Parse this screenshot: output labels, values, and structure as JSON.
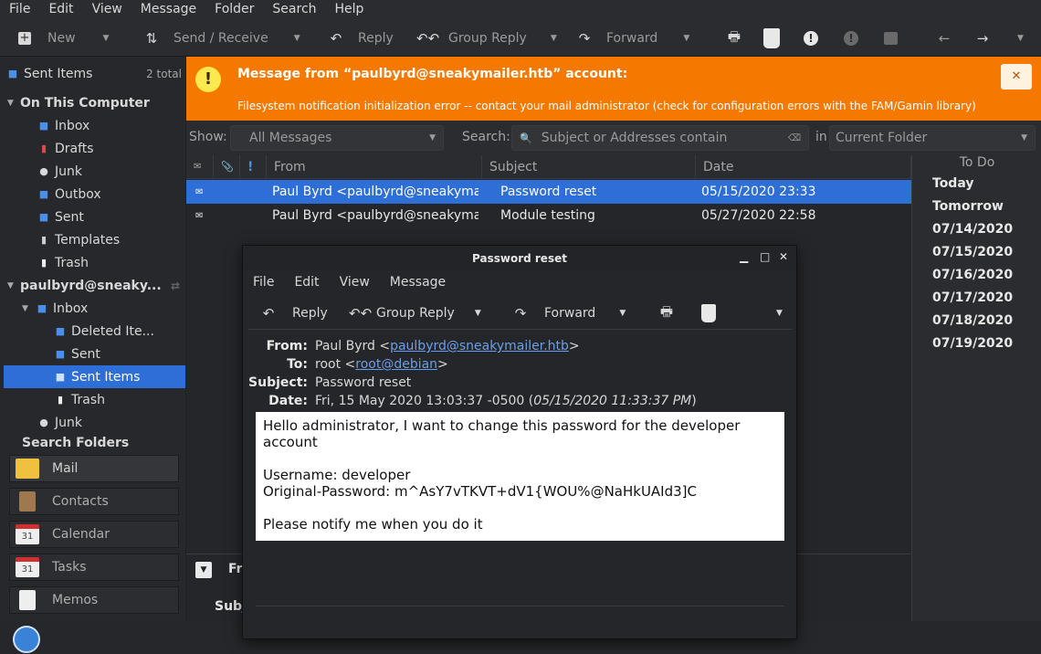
{
  "menubar": [
    "File",
    "Edit",
    "View",
    "Message",
    "Folder",
    "Search",
    "Help"
  ],
  "toolbar": {
    "new": "New",
    "send_receive": "Send / Receive",
    "reply": "Reply",
    "group_reply": "Group Reply",
    "forward": "Forward"
  },
  "sidebar": {
    "current_folder": "Sent Items",
    "current_count": "2 total",
    "on_this_computer": "On This Computer",
    "local": [
      "Inbox",
      "Drafts",
      "Junk",
      "Outbox",
      "Sent",
      "Templates",
      "Trash"
    ],
    "account": "paulbyrd@sneaky...",
    "account_inbox": "Inbox",
    "account_sub": [
      "Deleted Ite...",
      "Sent",
      "Sent Items",
      "Trash"
    ],
    "account_junk": "Junk",
    "search_folders": "Search Folders"
  },
  "switcher": [
    "Mail",
    "Contacts",
    "Calendar",
    "Tasks",
    "Memos"
  ],
  "banner": {
    "title": "Message from “paulbyrd@sneakymailer.htb” account:",
    "detail": "Filesystem notification initialization error -- contact your mail administrator (check for configuration errors with the FAM/Gamin library)",
    "close": "✕"
  },
  "search": {
    "show_label": "Show:",
    "show_value": "All Messages",
    "search_label": "Search:",
    "search_placeholder": "Subject or Addresses contain",
    "in_label": "in",
    "in_value": "Current Folder"
  },
  "columns": {
    "from": "From",
    "subject": "Subject",
    "date": "Date"
  },
  "messages": [
    {
      "from": "Paul Byrd <paulbyrd@sneakyma...",
      "subject": "Password reset",
      "date": "05/15/2020 23:33"
    },
    {
      "from": "Paul Byrd <paulbyrd@sneakyma...",
      "subject": "Module testing",
      "date": "05/27/2020 22:58"
    }
  ],
  "preview": {
    "from_label": "Fr",
    "subject_label": "Subj"
  },
  "todo": {
    "title": "To Do",
    "dates": [
      "Today",
      "Tomorrow",
      "07/14/2020",
      "07/15/2020",
      "07/16/2020",
      "07/17/2020",
      "07/18/2020",
      "07/19/2020"
    ]
  },
  "popup": {
    "title": "Password reset",
    "menu": [
      "File",
      "Edit",
      "View",
      "Message"
    ],
    "reply": "Reply",
    "group_reply": "Group Reply",
    "forward": "Forward",
    "labels": {
      "from": "From:",
      "to": "To:",
      "subject": "Subject:",
      "date": "Date:"
    },
    "from_name": "Paul Byrd <",
    "from_email": "paulbyrd@sneakymailer.htb",
    "from_end": ">",
    "to_name": "root <",
    "to_email": "root@debian",
    "to_end": ">",
    "subject": "Password reset",
    "date_plain": "Fri, 15 May 2020 13:03:37 -0500 (",
    "date_local": "05/15/2020 11:33:37 PM",
    "date_end": ")",
    "body": [
      "Hello administrator, I want to change this password for the developer",
      "account",
      "",
      "Username: developer",
      "Original-Password: m^AsY7vTKVT+dV1{WOU%@NaHkUAId3]C",
      "",
      "Please notify me when you do it"
    ]
  },
  "colors": {
    "accent": "#2d6fd6",
    "banner": "#f57900",
    "link": "#6a9fe8"
  }
}
